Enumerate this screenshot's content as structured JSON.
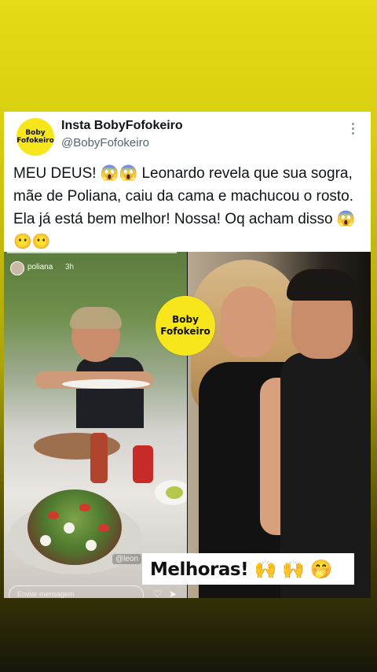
{
  "post": {
    "avatar_line1": "Boby",
    "avatar_line2": "Fofokeiro",
    "display_name": "Insta BobyFofokeiro",
    "handle": "@BobyFofokeiro",
    "more_icon": "more-vertical-icon",
    "text": "MEU DEUS! 😱😱 Leonardo revela que sua sogra, mãe de Poliana, caiu da cama e machucou o rosto. Ela já está bem melhor! Nossa! Oq acham disso 😱😶😶"
  },
  "media": {
    "left": {
      "story_user": "poliana",
      "story_time": "3h",
      "tag": "@leon",
      "message_placeholder": "Enviar mensagem"
    },
    "right": {}
  },
  "badge": {
    "line1": "Boby",
    "line2": "Fofokeiro"
  },
  "caption": {
    "text": "Melhoras! 🙌 🙌 🤭"
  },
  "colors": {
    "background_top": "#e4dc16",
    "badge_yellow": "#f8e61c",
    "text_primary": "#0f1419",
    "text_secondary": "#536471"
  }
}
